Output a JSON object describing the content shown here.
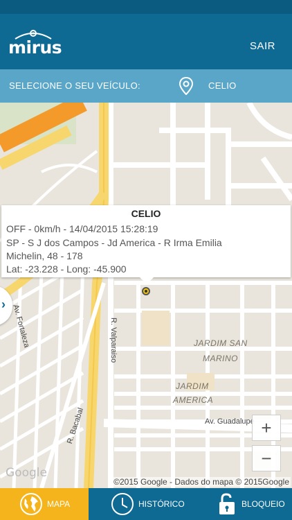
{
  "header": {
    "logo_text": "mirus",
    "logout_label": "SAIR"
  },
  "vehicle_bar": {
    "label": "SELECIONE O SEU VEÍCULO:",
    "selected_vehicle": "CELIO"
  },
  "info_window": {
    "title": "CELIO",
    "status_line": "OFF - 0km/h - 14/04/2015 15:28:19",
    "address_line_1": " SP - S J dos Campos - Jd America - R Irma Emilia",
    "address_line_2": "Michelin, 48 - 178",
    "coords_line": " Lat: -23.228 - Long: -45.900"
  },
  "map": {
    "area_labels": [
      "JARDIM SAN",
      "MARINO",
      "JARDIM",
      "AMERICA"
    ],
    "street_labels": [
      "R. Valparaiso",
      "Av. Guadalupe",
      "R. Bacabal",
      "Av. Fortaleza"
    ],
    "side_tab_glyph": "›",
    "zoom_in_label": "+",
    "zoom_out_label": "−",
    "google_logo": "Google",
    "copyright": "©2015 Google - Dados do mapa © 2015Google"
  },
  "bottom_nav": {
    "items": [
      {
        "label": "MAPA",
        "icon": "globe-icon",
        "active": true
      },
      {
        "label": "HISTÓRICO",
        "icon": "clock-icon",
        "active": false
      },
      {
        "label": "BLOQUEIO",
        "icon": "unlock-icon",
        "active": false
      }
    ]
  },
  "colors": {
    "primary": "#0e6a93",
    "secondary": "#5aa6c8",
    "accent": "#f5b41c"
  }
}
